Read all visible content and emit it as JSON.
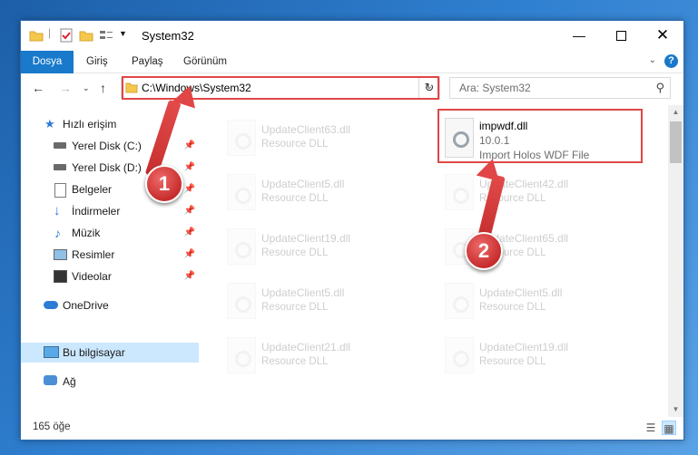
{
  "window": {
    "title": "System32"
  },
  "ribbon": {
    "tabs": [
      "Dosya",
      "Giriş",
      "Paylaş",
      "Görünüm"
    ],
    "help_label": "?"
  },
  "nav": {
    "address": "C:\\Windows\\System32",
    "search_placeholder": "Ara: System32"
  },
  "sidebar": {
    "items": [
      {
        "label": "Hızlı erişim",
        "icon": "star-icon"
      },
      {
        "label": "Yerel Disk (C:)",
        "icon": "drive-icon",
        "pinned": true
      },
      {
        "label": "Yerel Disk (D:)",
        "icon": "drive-icon",
        "pinned": true
      },
      {
        "label": "Belgeler",
        "icon": "documents-icon",
        "pinned": true
      },
      {
        "label": "İndirmeler",
        "icon": "downloads-icon",
        "pinned": true
      },
      {
        "label": "Müzik",
        "icon": "music-icon",
        "pinned": true
      },
      {
        "label": "Resimler",
        "icon": "pictures-icon",
        "pinned": true
      },
      {
        "label": "Videolar",
        "icon": "videos-icon",
        "pinned": true
      },
      {
        "label": "OneDrive",
        "icon": "cloud-icon"
      },
      {
        "label": "Bu bilgisayar",
        "icon": "computer-icon",
        "selected": true
      },
      {
        "label": "Ağ",
        "icon": "network-icon"
      }
    ]
  },
  "files": {
    "focused": {
      "name": "impwdf.dll",
      "version": "10.0.1",
      "description": "Import Holos WDF File"
    },
    "faded": [
      {
        "name": "UpdateClient63.dll",
        "description": "Resource DLL"
      },
      {
        "name": "UpdateClient5.dll",
        "description": "Resource DLL"
      },
      {
        "name": "UpdateClient42.dll",
        "description": "Resource DLL"
      },
      {
        "name": "UpdateClient19.dll",
        "description": "Resource DLL"
      },
      {
        "name": "UpdateClient65.dll",
        "description": "Resource DLL"
      },
      {
        "name": "UpdateClient5.dll",
        "description": "Resource DLL"
      },
      {
        "name": "UpdateClient5.dll",
        "description": "Resource DLL"
      },
      {
        "name": "UpdateClient21.dll",
        "description": "Resource DLL"
      },
      {
        "name": "UpdateClient19.dll",
        "description": "Resource DLL"
      }
    ]
  },
  "status": {
    "count": "165 öğe"
  },
  "callouts": {
    "one": "1",
    "two": "2"
  },
  "colors": {
    "accent": "#1979ca",
    "highlight": "#e04646",
    "selected": "#cce8ff"
  }
}
